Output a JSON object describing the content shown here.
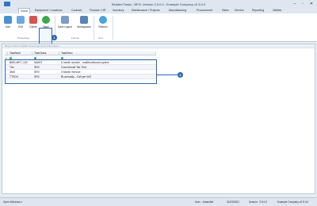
{
  "window": {
    "title": "Related Tasks - BPO: Version 2.5.0.0 : Example Company v2.5.0.0",
    "minimize": "–",
    "maximize": "▫",
    "close": "✕"
  },
  "ribbon_tabs": [
    "Home",
    "Equipment / Locations",
    "Contract",
    "Finance / HR",
    "Inventory",
    "Maintenance / Projects",
    "Manufacturing",
    "Procurement",
    "Sales",
    "Service",
    "Reporting",
    "Utilities"
  ],
  "ribbon": {
    "add": "Add",
    "edit": "Edit",
    "delete": "Delete",
    "back": "Back",
    "save_layout": "Save Layout",
    "workspaces": "Workspaces",
    "refresh": "Refresh",
    "group_processing": "Processing",
    "group_format": "Format",
    "group_current": "Curr..."
  },
  "callouts": {
    "first": "1",
    "second": "2"
  },
  "grid": {
    "drag_hint": "Drag a column header here to group by that column",
    "columns": [
      "TaskNum",
      "TaskClass",
      "TaskDesc"
    ],
    "rows": [
      [
        "BMS-MFC-100",
        "MAINT",
        "6 month service - multifunctional copiers"
      ],
      [
        "Tier",
        "SRV",
        "Commercial Tier Test"
      ],
      [
        "3MS",
        "SRV",
        "3 Month Service"
      ],
      [
        "TTSO4",
        "SRV",
        "Bi-annually - Call per WO"
      ]
    ]
  },
  "statusbar": {
    "open_windows": "Open Windows ▾",
    "user": "User : Jubandell",
    "date": "21/03/2021",
    "version": "Version : 2.5.0.0",
    "company": "Example Company v2.5.0.0"
  },
  "colors": {
    "accent": "#2a64b8",
    "filter_green": "#3caa48"
  }
}
